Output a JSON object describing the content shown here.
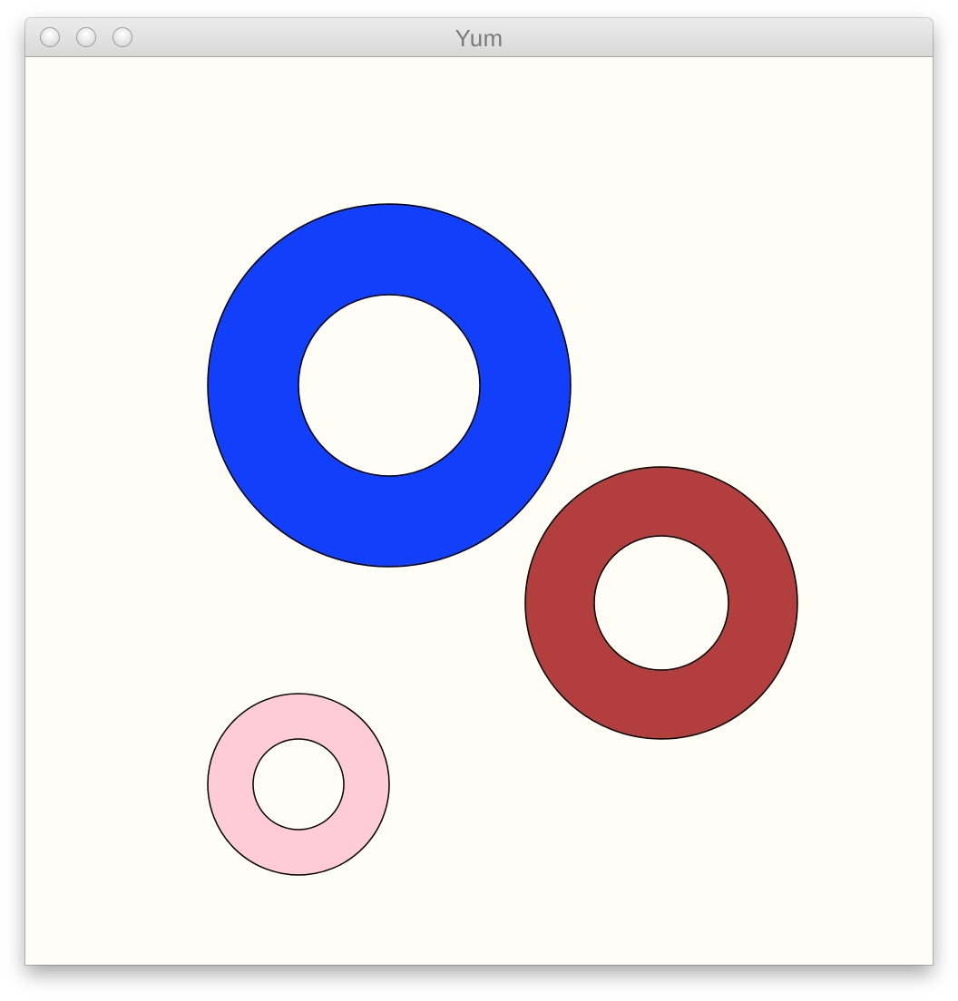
{
  "window": {
    "title": "Yum",
    "controls": {
      "close": "close-button",
      "minimize": "minimize-button",
      "zoom": "zoom-button"
    }
  },
  "canvas": {
    "background": "#fdfdf6",
    "stroke": "#000000",
    "rings": [
      {
        "name": "blue-ring",
        "outer_color": "#123ffa",
        "inner_color": "#fdfdf6"
      },
      {
        "name": "red-ring",
        "outer_color": "#b23e3e",
        "inner_color": "#fdfdf6"
      },
      {
        "name": "pink-ring",
        "outer_color": "#ffccd6",
        "inner_color": "#fdfdf6"
      }
    ]
  }
}
